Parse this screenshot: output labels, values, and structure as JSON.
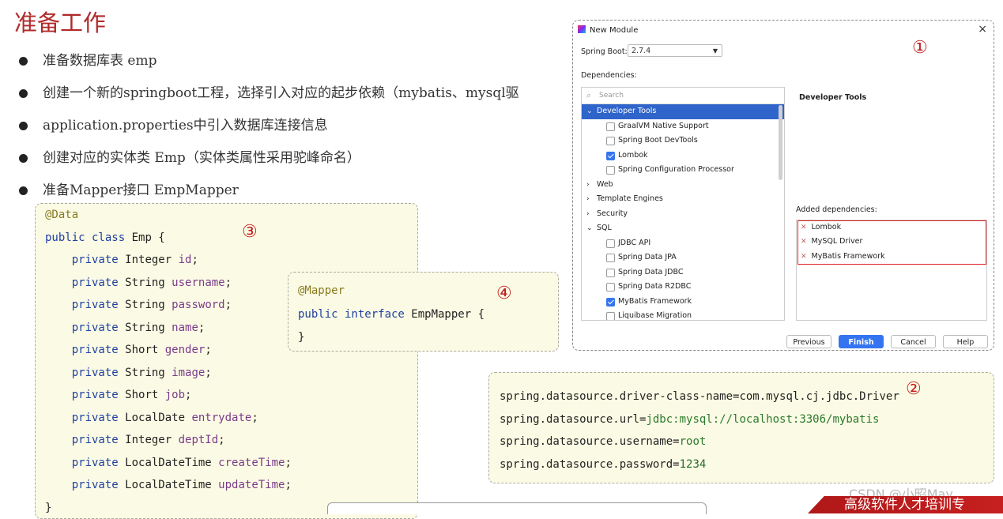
{
  "slide": {
    "title": "准备工作",
    "bullets": [
      "准备数据库表 emp",
      "创建一个新的springboot工程，选择引入对应的起步依赖（mybatis、mysql驱",
      "application.properties中引入数据库连接信息",
      "创建对应的实体类 Emp（实体类属性采用驼峰命名）",
      "准备Mapper接口 EmpMapper"
    ]
  },
  "badges": {
    "b1": "①",
    "b2": "②",
    "b3": "③",
    "b4": "④"
  },
  "emp_class": {
    "annotation": "@Data",
    "decl_kw": "public class",
    "decl_name": " Emp {",
    "fields": [
      {
        "mod": "private",
        "type": " Integer ",
        "name": "id",
        "end": ";"
      },
      {
        "mod": "private",
        "type": " String ",
        "name": "username",
        "end": ";"
      },
      {
        "mod": "private",
        "type": " String ",
        "name": "password",
        "end": ";"
      },
      {
        "mod": "private",
        "type": " String ",
        "name": "name",
        "end": ";"
      },
      {
        "mod": "private",
        "type": " Short ",
        "name": "gender",
        "end": ";"
      },
      {
        "mod": "private",
        "type": " String ",
        "name": "image",
        "end": ";"
      },
      {
        "mod": "private",
        "type": " Short ",
        "name": "job",
        "end": ";"
      },
      {
        "mod": "private",
        "type": " LocalDate ",
        "name": "entrydate",
        "end": ";"
      },
      {
        "mod": "private",
        "type": " Integer ",
        "name": "deptId",
        "end": ";"
      },
      {
        "mod": "private",
        "type": " LocalDateTime ",
        "name": "createTime",
        "end": ";"
      },
      {
        "mod": "private",
        "type": " LocalDateTime ",
        "name": "updateTime",
        "end": ";"
      }
    ],
    "close": "}"
  },
  "mapper": {
    "annotation": "@Mapper",
    "decl_kw": "public interface",
    "decl_name": " EmpMapper {",
    "close": "}"
  },
  "props": [
    {
      "key": "spring.datasource.driver-class-name",
      "eq": "=",
      "value": "com.mysql.cj.jdbc.Driver"
    },
    {
      "key": "spring.datasource.url",
      "eq": "=",
      "value": "jdbc:mysql://localhost:3306/mybatis"
    },
    {
      "key": "spring.datasource.username",
      "eq": "=",
      "value": "root"
    },
    {
      "key": "spring.datasource.password",
      "eq": "=",
      "value": "1234"
    }
  ],
  "dialog": {
    "title": "New Module",
    "close_icon": "×",
    "spring_boot_label": "Spring Boot:",
    "spring_boot_value": "2.7.4",
    "dependencies_label": "Dependencies:",
    "search_placeholder": "Search",
    "tree": [
      {
        "label": "Developer Tools",
        "kind": "group",
        "expanded": true,
        "selected": true
      },
      {
        "label": "GraalVM Native Support",
        "kind": "item",
        "checked": false
      },
      {
        "label": "Spring Boot DevTools",
        "kind": "item",
        "checked": false
      },
      {
        "label": "Lombok",
        "kind": "item",
        "checked": true
      },
      {
        "label": "Spring Configuration Processor",
        "kind": "item",
        "checked": false
      },
      {
        "label": "Web",
        "kind": "group",
        "expanded": false
      },
      {
        "label": "Template Engines",
        "kind": "group",
        "expanded": false
      },
      {
        "label": "Security",
        "kind": "group",
        "expanded": false
      },
      {
        "label": "SQL",
        "kind": "group",
        "expanded": true
      },
      {
        "label": "JDBC API",
        "kind": "item",
        "checked": false
      },
      {
        "label": "Spring Data JPA",
        "kind": "item",
        "checked": false
      },
      {
        "label": "Spring Data JDBC",
        "kind": "item",
        "checked": false
      },
      {
        "label": "Spring Data R2DBC",
        "kind": "item",
        "checked": false
      },
      {
        "label": "MyBatis Framework",
        "kind": "item",
        "checked": true
      },
      {
        "label": "Liquibase Migration",
        "kind": "item",
        "checked": false
      }
    ],
    "detail_title": "Developer Tools",
    "added_label": "Added dependencies:",
    "added": [
      "Lombok",
      "MySQL Driver",
      "MyBatis Framework"
    ],
    "buttons": {
      "previous": "Previous",
      "finish": "Finish",
      "cancel": "Cancel",
      "help": "Help"
    }
  },
  "footer": {
    "banner": "高级软件人才培训专",
    "watermark": "CSDN @小昭May"
  },
  "colors": {
    "title": "#b02a2a",
    "badge": "#c02020",
    "accent": "#3574f0",
    "code_bg": "#fbfbe5"
  }
}
